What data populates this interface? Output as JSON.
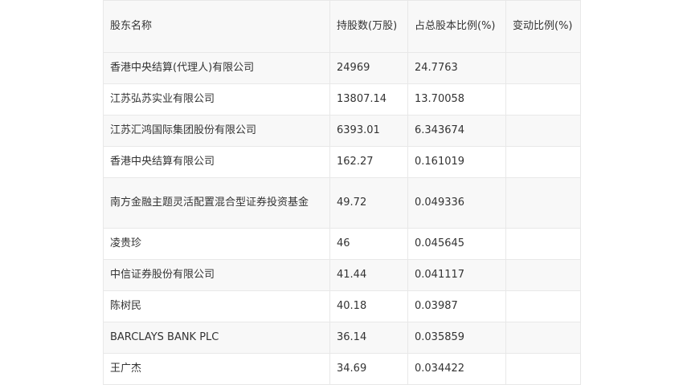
{
  "table": {
    "headers": [
      "股东名称",
      "持股数(万股)",
      "占总股本比例(%)",
      "变动比例(%)"
    ],
    "rows": [
      [
        "香港中央结算(代理人)有限公司",
        "24969",
        "24.7763",
        ""
      ],
      [
        "江苏弘苏实业有限公司",
        "13807.14",
        "13.70058",
        ""
      ],
      [
        "江苏汇鸿国际集团股份有限公司",
        "6393.01",
        "6.343674",
        ""
      ],
      [
        "香港中央结算有限公司",
        "162.27",
        "0.161019",
        ""
      ],
      [
        "南方金融主题灵活配置混合型证券投资基金",
        "49.72",
        "0.049336",
        ""
      ],
      [
        "凌贵珍",
        "46",
        "0.045645",
        ""
      ],
      [
        "中信证券股份有限公司",
        "41.44",
        "0.041117",
        ""
      ],
      [
        "陈树民",
        "40.18",
        "0.03987",
        ""
      ],
      [
        "BARCLAYS BANK PLC",
        "36.14",
        "0.035859",
        ""
      ],
      [
        "王广杰",
        "34.69",
        "0.034422",
        ""
      ]
    ]
  }
}
